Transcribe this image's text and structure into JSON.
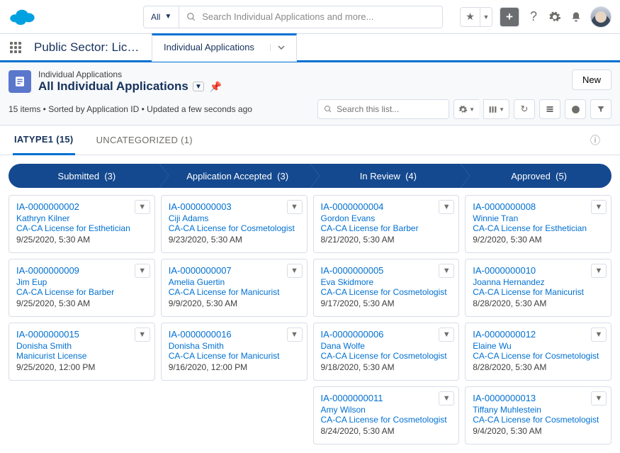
{
  "header": {
    "scope": "All",
    "search_placeholder": "Search Individual Applications and more...",
    "app_name": "Public Sector: Lice...",
    "nav_tab": "Individual Applications"
  },
  "page": {
    "object_label": "Individual Applications",
    "list_view": "All Individual Applications",
    "new_button": "New",
    "meta": "15 items • Sorted by Application ID • Updated a few seconds ago",
    "list_search_placeholder": "Search this list..."
  },
  "filter_tabs": {
    "t0": "IATYPE1 (15)",
    "t1": "UNCATEGORIZED (1)"
  },
  "stages": {
    "s0": {
      "label": "Submitted",
      "count": "(3)"
    },
    "s1": {
      "label": "Application Accepted",
      "count": "(3)"
    },
    "s2": {
      "label": "In Review",
      "count": "(4)"
    },
    "s3": {
      "label": "Approved",
      "count": "(5)"
    }
  },
  "cols": [
    [
      {
        "id": "IA-0000000002",
        "name": "Kathryn Kilner",
        "lic": "CA-CA License for Esthetician",
        "date": "9/25/2020, 5:30 AM"
      },
      {
        "id": "IA-0000000009",
        "name": "Jim Eup",
        "lic": "CA-CA License for Barber",
        "date": "9/25/2020, 5:30 AM"
      },
      {
        "id": "IA-0000000015",
        "name": "Donisha Smith",
        "lic": "Manicurist License",
        "date": "9/25/2020, 12:00 PM"
      }
    ],
    [
      {
        "id": "IA-0000000003",
        "name": "Ciji Adams",
        "lic": "CA-CA License for Cosmetologist",
        "date": "9/23/2020, 5:30 AM"
      },
      {
        "id": "IA-0000000007",
        "name": "Amelia Guertin",
        "lic": "CA-CA License for Manicurist",
        "date": "9/9/2020, 5:30 AM"
      },
      {
        "id": "IA-0000000016",
        "name": "Donisha Smith",
        "lic": "CA-CA License for Manicurist",
        "date": "9/16/2020, 12:00 PM"
      }
    ],
    [
      {
        "id": "IA-0000000004",
        "name": "Gordon Evans",
        "lic": "CA-CA License for Barber",
        "date": "8/21/2020, 5:30 AM"
      },
      {
        "id": "IA-0000000005",
        "name": "Eva Skidmore",
        "lic": "CA-CA License for Cosmetologist",
        "date": "9/17/2020, 5:30 AM"
      },
      {
        "id": "IA-0000000006",
        "name": "Dana Wolfe",
        "lic": "CA-CA License for Cosmetologist",
        "date": "9/18/2020, 5:30 AM"
      },
      {
        "id": "IA-0000000011",
        "name": "Amy Wilson",
        "lic": "CA-CA License for Cosmetologist",
        "date": "8/24/2020, 5:30 AM"
      }
    ],
    [
      {
        "id": "IA-0000000008",
        "name": "Winnie Tran",
        "lic": "CA-CA License for Esthetician",
        "date": "9/2/2020, 5:30 AM"
      },
      {
        "id": "IA-0000000010",
        "name": "Joanna Hernandez",
        "lic": "CA-CA License for Manicurist",
        "date": "8/28/2020, 5:30 AM"
      },
      {
        "id": "IA-0000000012",
        "name": "Elaine Wu",
        "lic": "CA-CA License for Cosmetologist",
        "date": "8/28/2020, 5:30 AM"
      },
      {
        "id": "IA-0000000013",
        "name": "Tiffany Muhlestein",
        "lic": "CA-CA License for Cosmetologist",
        "date": "9/4/2020, 5:30 AM"
      }
    ]
  ]
}
